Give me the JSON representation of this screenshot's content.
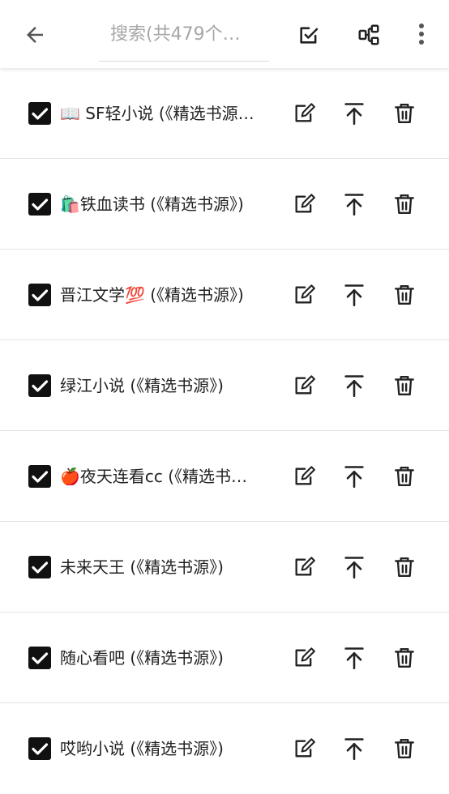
{
  "toolbar": {
    "search_placeholder": "搜索(共479个…",
    "back_icon": "arrow-left-icon",
    "select_icon": "edit-checkbox-icon",
    "group_icon": "group-tree-icon",
    "more_icon": "more-vert-icon"
  },
  "sources": [
    {
      "label": "📖 SF轻小说 (《精选书源…",
      "checked": true
    },
    {
      "label": "🛍️铁血读书 (《精选书源》)",
      "checked": true
    },
    {
      "label": "晋江文学💯 (《精选书源》)",
      "checked": true
    },
    {
      "label": "绿江小说 (《精选书源》)",
      "checked": true
    },
    {
      "label": "🍎夜天连看cc (《精选书…",
      "checked": true
    },
    {
      "label": "未来天王 (《精选书源》)",
      "checked": true
    },
    {
      "label": "随心看吧 (《精选书源》)",
      "checked": true
    },
    {
      "label": "哎哟小说 (《精选书源》)",
      "checked": true
    }
  ],
  "row_actions": [
    "edit-icon",
    "move-to-top-icon",
    "delete-icon"
  ]
}
